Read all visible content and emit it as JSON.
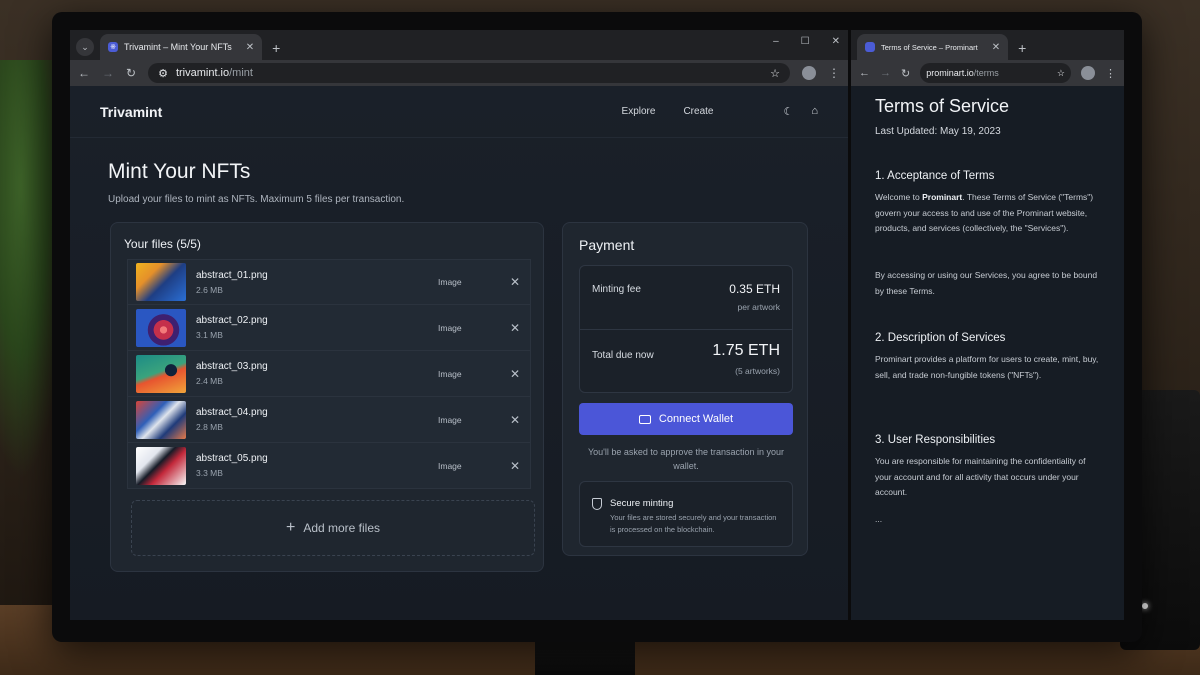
{
  "left_window": {
    "tab_title": "Trivamint – Mint Your NFTs",
    "favicon_glyph": "※",
    "url_host": "trivamint.io",
    "url_path": "/mint",
    "brand": "Trivamint",
    "nav": [
      "Explore",
      "Create"
    ],
    "icons": [
      "moon-icon",
      "home-icon"
    ],
    "title": "Mint Your NFTs",
    "subtitle": "Upload your files to mint as NFTs. Maximum 5 files per transaction.",
    "files": {
      "title": "Your files (5/5)",
      "items": [
        {
          "name": "abstract_01.png",
          "size": "2.6 MB",
          "type": "Image"
        },
        {
          "name": "abstract_02.png",
          "size": "3.1 MB",
          "type": "Image"
        },
        {
          "name": "abstract_03.png",
          "size": "2.4 MB",
          "type": "Image"
        },
        {
          "name": "abstract_04.png",
          "size": "2.8 MB",
          "type": "Image"
        },
        {
          "name": "abstract_05.png",
          "size": "3.3 MB",
          "type": "Image"
        }
      ],
      "add_more": "Add more files"
    },
    "payment": {
      "title": "Payment",
      "fee_label": "Minting fee",
      "fee_value": "0.35 ETH",
      "fee_unit": "per artwork",
      "due_label": "Total due now",
      "due_value": "1.75 ETH",
      "due_count": "(5 artworks)",
      "connect": "Connect Wallet",
      "approve_note": "You'll be asked to approve the transaction in your wallet.",
      "secure_title": "Secure minting",
      "secure_desc": "Your files are stored securely and your transaction is processed on the blockchain."
    }
  },
  "right_window": {
    "tab_title": "Terms of Service – Prominart",
    "url_host": "prominart.io",
    "url_path": "/terms",
    "title": "Terms of Service",
    "updated": "Last Updated: May 19, 2023",
    "s1_heading": "1. Acceptance of Terms",
    "s1_p1_pre": "Welcome to ",
    "s1_p1_brand": "Prominart",
    "s1_p1_post": ". These Terms of Service (\"Terms\") govern your access to and use of the Prominart website, products, and services (collectively, the \"Services\").",
    "s1_p2": "By accessing or using our Services, you agree to be bound by these Terms.",
    "s2_heading": "2. Description of Services",
    "s2_p": "Prominart provides a platform for users to create, mint, buy, sell, and trade non-fungible tokens (\"NFTs\").",
    "s3_heading": "3. User Responsibilities",
    "s3_p": "You are responsible for maintaining the confidentiality of your account and for all activity that occurs under your account.",
    "ellipsis": "..."
  }
}
